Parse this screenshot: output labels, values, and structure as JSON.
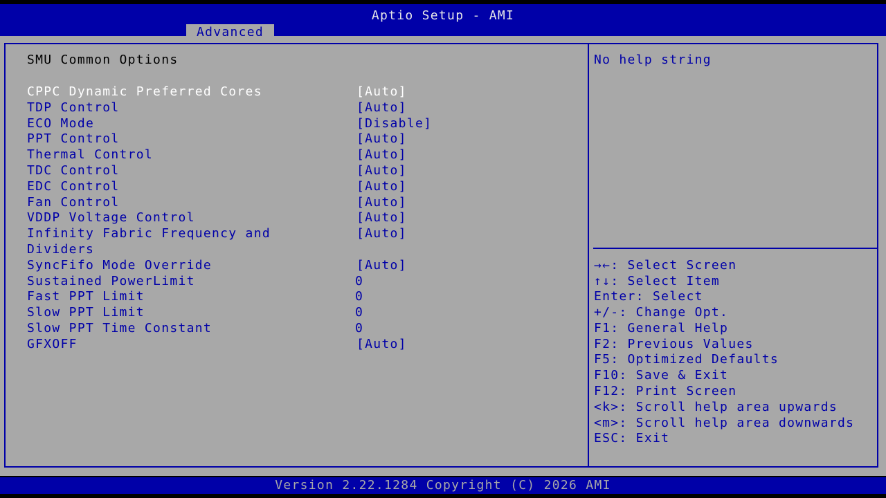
{
  "header": {
    "title": "Aptio Setup - AMI",
    "tabs": [
      {
        "label": "Advanced",
        "active": true
      }
    ]
  },
  "page": {
    "section_title": "SMU Common Options"
  },
  "options": [
    {
      "label": "CPPC Dynamic Preferred Cores",
      "value": "[Auto]",
      "selected": true
    },
    {
      "label": "TDP Control",
      "value": "[Auto]"
    },
    {
      "label": "ECO Mode",
      "value": "[Disable]"
    },
    {
      "label": "PPT Control",
      "value": "[Auto]"
    },
    {
      "label": "Thermal Control",
      "value": "[Auto]"
    },
    {
      "label": "TDC Control",
      "value": "[Auto]"
    },
    {
      "label": "EDC Control",
      "value": "[Auto]"
    },
    {
      "label": "Fan Control",
      "value": "[Auto]"
    },
    {
      "label": "VDDP Voltage Control",
      "value": "[Auto]"
    },
    {
      "label": "Infinity Fabric Frequency and",
      "label_line2": "Dividers",
      "value": "[Auto]"
    },
    {
      "label": "SyncFifo Mode Override",
      "value": "[Auto]"
    },
    {
      "label": "Sustained PowerLimit",
      "value": "0"
    },
    {
      "label": "Fast PPT Limit",
      "value": "0"
    },
    {
      "label": "Slow PPT Limit",
      "value": "0"
    },
    {
      "label": "Slow PPT Time Constant",
      "value": "0"
    },
    {
      "label": "GFXOFF",
      "value": "[Auto]"
    }
  ],
  "help": {
    "text": "No help string"
  },
  "keys": [
    "→←: Select Screen",
    "↑↓: Select Item",
    "Enter: Select",
    "+/-: Change Opt.",
    "F1: General Help",
    "F2: Previous Values",
    "F5: Optimized Defaults",
    "F10: Save & Exit",
    "F12: Print Screen",
    "<k>: Scroll help area upwards",
    "<m>: Scroll help area downwards",
    "ESC: Exit"
  ],
  "footer": {
    "version": "Version 2.22.1284 Copyright (C) 2026 AMI"
  },
  "colors": {
    "bios_blue": "#0000a8",
    "bios_gray": "#a8a8a8",
    "highlight_white": "#ffffff",
    "text_black": "#000000"
  }
}
